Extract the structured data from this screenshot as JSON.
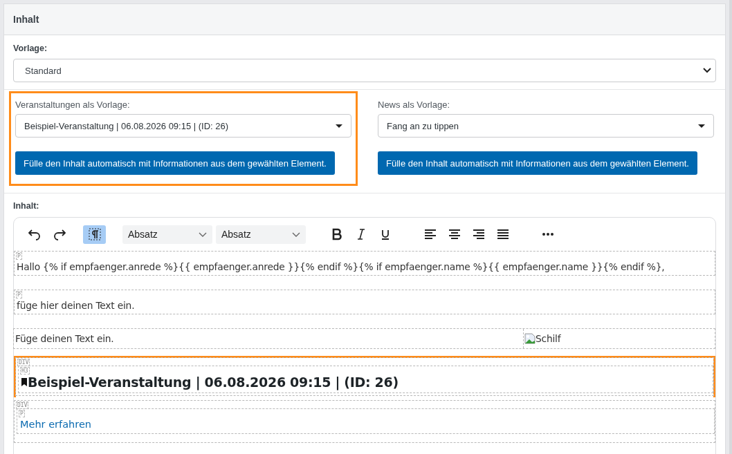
{
  "panel": {
    "title": "Inhalt"
  },
  "vorlage": {
    "label": "Vorlage:",
    "value": "Standard"
  },
  "sources": [
    {
      "label": "Veranstaltungen als Vorlage:",
      "value": "Beispiel-Veranstaltung | 06.08.2026 09:15 | (ID: 26)",
      "button": "Fülle den Inhalt automatisch mit Informationen aus dem gewählten Element.",
      "highlighted": true
    },
    {
      "label": "News als Vorlage:",
      "value": "Fang an zu tippen",
      "button": "Fülle den Inhalt automatisch mit Informationen aus dem gewählten Element.",
      "highlighted": false
    }
  ],
  "editor": {
    "label": "Inhalt:",
    "show_blocks": true,
    "dropdowns": [
      "Absatz",
      "Absatz"
    ],
    "blocks": [
      {
        "kind": "paragraph",
        "tag": "P",
        "text": "Hallo {% if empfaenger.anrede %}{{ empfaenger.anrede }}{% endif %}{% if empfaenger.name %}{{ empfaenger.name }}{% endif %},"
      },
      {
        "kind": "paragraph",
        "tag": "P",
        "text": "füge hier deinen Text ein."
      },
      {
        "kind": "row",
        "text": "Füge deinen Text ein.",
        "image_alt": "Schilf"
      },
      {
        "kind": "heading",
        "tags": [
          "DIV",
          "H3"
        ],
        "text": "Beispiel-Veranstaltung | 06.08.2026 09:15 | (ID: 26)",
        "highlighted": true
      },
      {
        "kind": "link",
        "tags": [
          "DIV",
          "P"
        ],
        "text": "Mehr erfahren"
      }
    ]
  }
}
